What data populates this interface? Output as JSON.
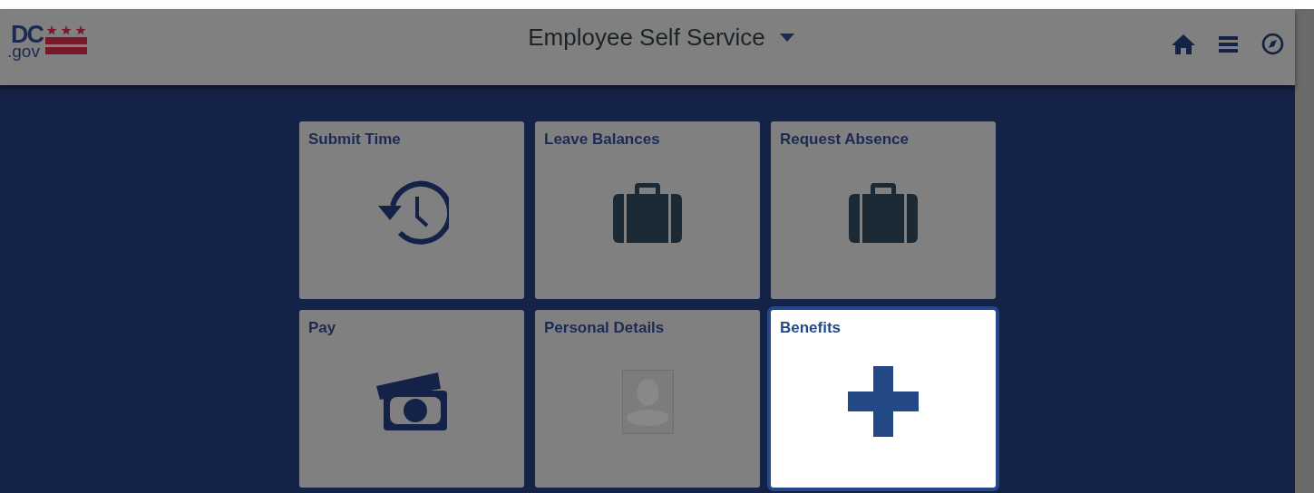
{
  "logo": {
    "primary": "DC",
    "secondary": ".gov"
  },
  "header": {
    "title": "Employee Self Service"
  },
  "tiles": [
    {
      "title": "Submit Time",
      "selected": false
    },
    {
      "title": "Leave Balances",
      "selected": false
    },
    {
      "title": "Request Absence",
      "selected": false
    },
    {
      "title": "Pay",
      "selected": false
    },
    {
      "title": "Personal Details",
      "selected": false
    },
    {
      "title": "Benefits",
      "selected": true
    }
  ]
}
